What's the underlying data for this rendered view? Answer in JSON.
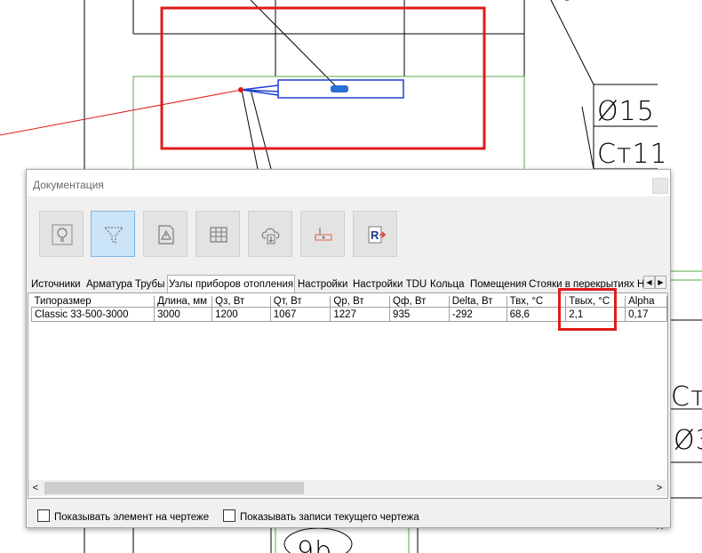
{
  "cad": {
    "label_1": "Ø15",
    "label_2": "Ст11",
    "label_3": "Ст",
    "label_4": "Ø3",
    "label_5": "9b"
  },
  "window": {
    "title": "Документация"
  },
  "toolbar": {
    "buttons": [
      {
        "icon": "lightbulb-icon"
      },
      {
        "icon": "filter-icon",
        "active": true
      },
      {
        "icon": "warning-icon"
      },
      {
        "icon": "table-icon"
      },
      {
        "icon": "cloud-download-icon"
      },
      {
        "icon": "heater-icon"
      },
      {
        "icon": "revit-export-icon"
      }
    ]
  },
  "tabs": [
    "Источники",
    "Арматура",
    "Трубы",
    "Узлы приборов отопления",
    "Настройки",
    "Настройки TDU",
    "Кольца",
    "Помещения",
    "Стояки в перекрытиях",
    "Н"
  ],
  "active_tab": "Узлы приборов отопления",
  "table": {
    "headers": [
      "Типоразмер",
      "Длина, мм",
      "Qз, Вт",
      "Qт, Вт",
      "Qр, Вт",
      "Qф, Вт",
      "Delta, Вт",
      "Твх, °C",
      "Твых, °C",
      "Alpha"
    ],
    "rows": [
      [
        "Classic 33-500-3000",
        "3000",
        "1200",
        "1067",
        "1227",
        "935",
        "-292",
        "68,6",
        "2,1",
        "0,17"
      ]
    ]
  },
  "footer": {
    "show_element": "Показывать элемент на чертеже",
    "show_records": "Показывать записи текущего чертежа"
  },
  "colors": {
    "accent": "#cce4f7",
    "highlight": "#e01b1b"
  }
}
